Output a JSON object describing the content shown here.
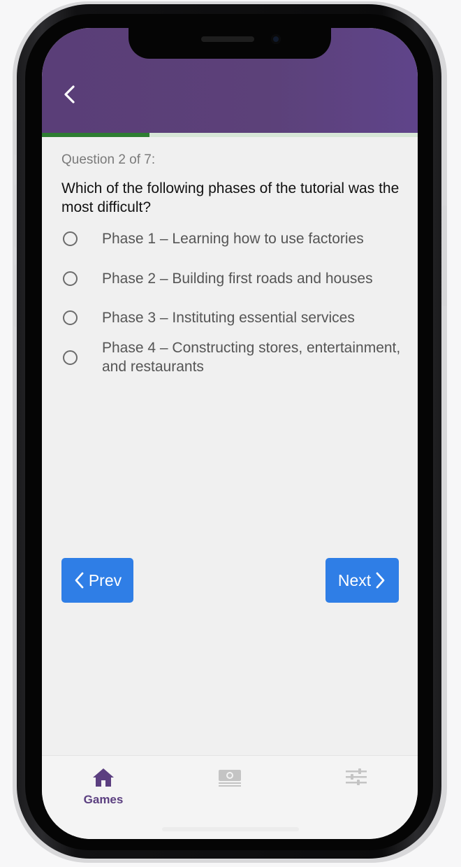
{
  "colors": {
    "header_bg": "#5c4179",
    "progress_fill": "#2e7d32",
    "progress_track": "#d7e6d7",
    "button_bg": "#2f7ee6",
    "tab_active": "#5b3f80",
    "tab_inactive": "#bdbdbd"
  },
  "header": {
    "back_icon": "chevron-left-icon",
    "progress": 0.2857
  },
  "quiz": {
    "counter": "Question 2 of 7:",
    "question": "Which of the following phases of the tutorial was the most difficult?",
    "options": [
      {
        "label": "Phase 1 – Learning how to use factories",
        "selected": false
      },
      {
        "label": "Phase 2 – Building first roads and houses",
        "selected": false
      },
      {
        "label": "Phase 3 – Instituting essential services",
        "selected": false
      },
      {
        "label": "Phase 4 – Constructing stores, entertainment, and restaurants",
        "selected": false
      }
    ]
  },
  "nav": {
    "prev_label": "Prev",
    "next_label": "Next"
  },
  "tabbar": {
    "tabs": [
      {
        "label": "Games",
        "icon": "home-icon",
        "active": true
      },
      {
        "label": "",
        "icon": "money-icon",
        "active": false
      },
      {
        "label": "",
        "icon": "sliders-icon",
        "active": false
      }
    ]
  }
}
